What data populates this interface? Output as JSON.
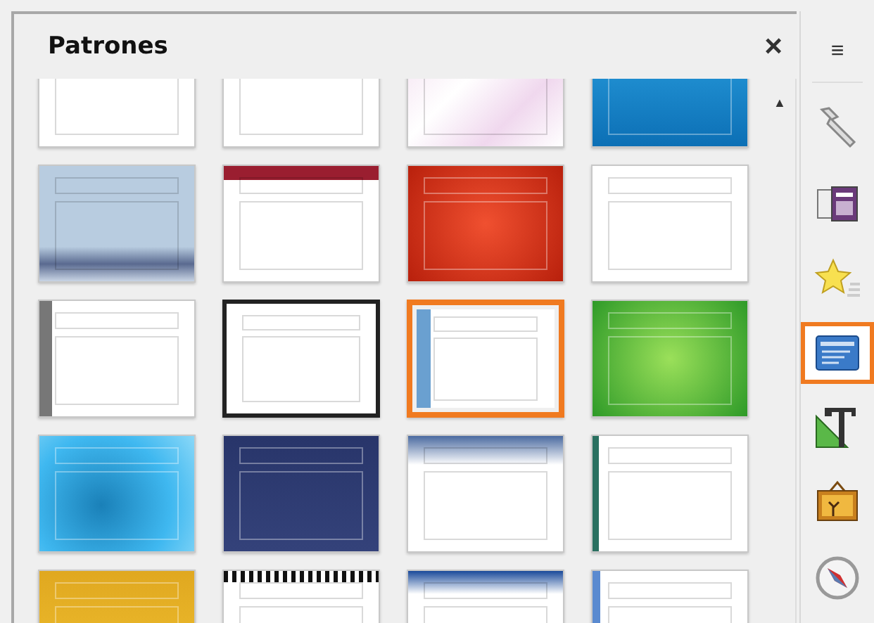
{
  "panel": {
    "title": "Patrones",
    "close_label": "×",
    "scroll_up": "▲"
  },
  "templates": [
    {
      "kind": "plain",
      "selected": false
    },
    {
      "kind": "white",
      "selected": false
    },
    {
      "kind": "pink",
      "selected": false
    },
    {
      "kind": "blue",
      "selected": false
    },
    {
      "kind": "sky",
      "selected": false
    },
    {
      "kind": "maroon",
      "selected": false
    },
    {
      "kind": "red",
      "selected": false
    },
    {
      "kind": "outline",
      "selected": false
    },
    {
      "kind": "beige",
      "selected": false
    },
    {
      "kind": "bold",
      "selected": false
    },
    {
      "kind": "dotted",
      "selected": true
    },
    {
      "kind": "green",
      "selected": false
    },
    {
      "kind": "aqua",
      "selected": false
    },
    {
      "kind": "navy",
      "selected": false
    },
    {
      "kind": "gradient",
      "selected": false
    },
    {
      "kind": "teal",
      "selected": false
    },
    {
      "kind": "gold",
      "selected": false
    },
    {
      "kind": "zebra",
      "selected": false
    },
    {
      "kind": "blueframe",
      "selected": false
    },
    {
      "kind": "sidebar",
      "selected": false
    }
  ],
  "sidebar": {
    "menu_label": "≡",
    "tabs": [
      {
        "kind": "properties",
        "selected": false
      },
      {
        "kind": "layouts",
        "selected": false
      },
      {
        "kind": "animation",
        "selected": false
      },
      {
        "kind": "masters",
        "selected": true
      },
      {
        "kind": "styles",
        "selected": false
      },
      {
        "kind": "gallery",
        "selected": false
      },
      {
        "kind": "navigator",
        "selected": false
      }
    ]
  }
}
